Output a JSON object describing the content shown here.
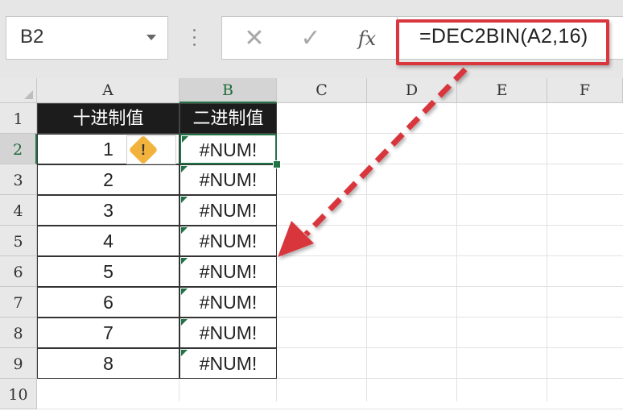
{
  "formula_bar": {
    "name_box": "B2",
    "cancel_glyph": "✕",
    "enter_glyph": "✓",
    "fx_label": "fx",
    "formula": "=DEC2BIN(A2,16)"
  },
  "columns": [
    "A",
    "B",
    "C",
    "D",
    "E",
    "F"
  ],
  "rows": [
    "1",
    "2",
    "3",
    "4",
    "5",
    "6",
    "7",
    "8",
    "9",
    "10"
  ],
  "table": {
    "headers": [
      "十进制值",
      "二进制值"
    ],
    "decimal": [
      "1",
      "2",
      "3",
      "4",
      "5",
      "6",
      "7",
      "8"
    ],
    "binary": [
      "#NUM!",
      "#NUM!",
      "#NUM!",
      "#NUM!",
      "#NUM!",
      "#NUM!",
      "#NUM!",
      "#NUM!"
    ]
  },
  "selection": {
    "active_cell": "B2"
  },
  "icons": {
    "error_warning": "warning-icon",
    "dropdown": "chevron-down-icon"
  },
  "colors": {
    "highlight_red": "#d9363e",
    "selection_green": "#217346",
    "header_fill": "#1c1c1c",
    "warning_fill": "#f2b33d"
  },
  "warning_glyph": "!"
}
